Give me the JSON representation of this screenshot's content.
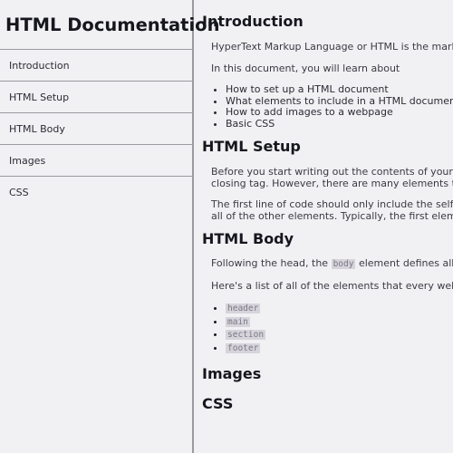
{
  "sidebar": {
    "title": "HTML Documentation",
    "items": [
      {
        "label": "Introduction"
      },
      {
        "label": "HTML Setup"
      },
      {
        "label": "HTML Body"
      },
      {
        "label": "Images"
      },
      {
        "label": "CSS"
      }
    ]
  },
  "main": {
    "introduction": {
      "header": "Introduction",
      "para1": "HyperText Markup Language or HTML is the markup lang",
      "para2": "In this document, you will learn about",
      "bullets": [
        "How to set up a HTML document",
        "What elements to include in a HTML document",
        "How to add images to a webpage",
        "Basic CSS"
      ]
    },
    "setup": {
      "header": "HTML Setup",
      "para1_line1": "Before you start writing out the contents of your webpag",
      "para1_line2": "closing tag. However, there are many elements that are s",
      "para2_line1": "The first line of code should only include the self-closing",
      "para2_line2": "all of the other elements. Typically, the first element to g"
    },
    "body": {
      "header": "HTML Body",
      "para1_before": "Following the head, the ",
      "para1_code": "body",
      "para1_after": " element defines all of the",
      "para2": "Here's a list of all of the elements that every webpage sh",
      "code_items": [
        "header",
        "main",
        "section",
        "footer"
      ]
    },
    "images": {
      "header": "Images"
    },
    "css": {
      "header": "CSS"
    }
  }
}
